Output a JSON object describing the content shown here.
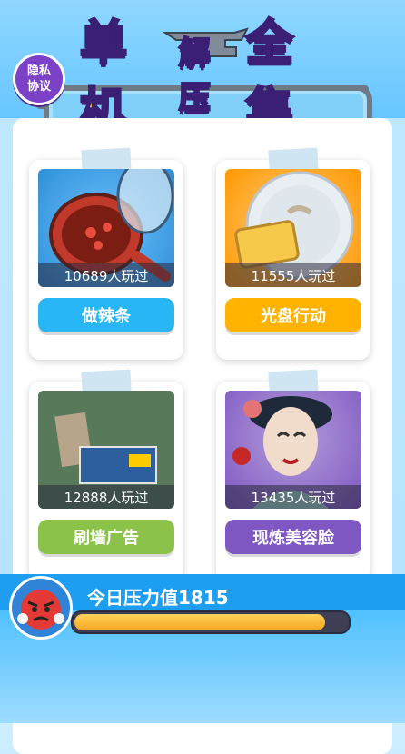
{
  "header": {
    "privacy_line1": "隐私",
    "privacy_line2": "协议",
    "title_part1": "单机",
    "title_part2": "解压",
    "title_part3": "全集"
  },
  "games": [
    {
      "name": "做辣条",
      "plays": "10689人玩过",
      "button_color": "#29b6f6",
      "bg_color": "#2e8fd6"
    },
    {
      "name": "光盘行动",
      "plays": "11555人玩过",
      "button_color": "#ffb300",
      "bg_color": "#ff9800"
    },
    {
      "name": "刷墙广告",
      "plays": "12888人玩过",
      "button_color": "#8bc34a",
      "bg_color": "#7cb342"
    },
    {
      "name": "现炼美容脸",
      "plays": "13435人玩过",
      "button_color": "#7e57c2",
      "bg_color": "#9575cd"
    }
  ],
  "pressure": {
    "label": "今日压力值",
    "value": "1815",
    "fill_fraction": 0.92
  },
  "icons": [
    "anvil-icon",
    "frying-pan-icon",
    "dish-sponge-icon",
    "wall-poster-icon",
    "opera-face-icon",
    "angry-face-icon"
  ]
}
